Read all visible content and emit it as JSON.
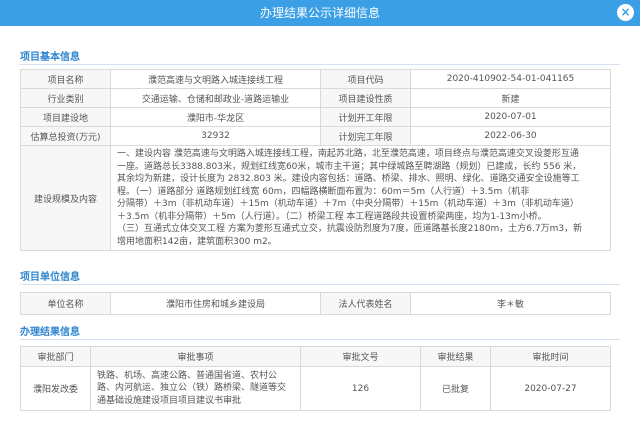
{
  "window": {
    "title": "办理结果公示详细信息",
    "close_label": "×"
  },
  "sections": {
    "basic": "项目基本信息",
    "unit": "项目单位信息",
    "result": "办理结果信息"
  },
  "basic": {
    "project_name_label": "项目名称",
    "project_name": "濮范高速与文明路入城连接线工程",
    "project_code_label": "项目代码",
    "project_code": "2020-410902-54-01-041165",
    "industry_label": "行业类别",
    "industry": "交通运输、仓储和邮政业-道路运输业",
    "nature_label": "项目建设性质",
    "nature": "新建",
    "location_label": "项目建设地",
    "location": "濮阳市-华龙区",
    "start_label": "计划开工年限",
    "start": "2020-07-01",
    "investment_label": "估算总投资(万元)",
    "investment": "32932",
    "finish_label": "计划完工年限",
    "finish": "2022-06-30",
    "scale_label": "建设规模及内容",
    "scale_lines": [
      "一、建设内容 濮范高速与文明路入城连接线工程，南起苏北路，北至濮范高速，项目终点与濮范高速交叉设菱形互通",
      "一座。道路总长3388.803米，规划红线宽60米，城市主干道；其中绿城路至聘湖路（规划）已建成，长约 556 米，",
      "其余均为新建，设计长度为 2832.803 米。建设内容包括：道路、桥梁、排水、照明、绿化、道路交通安全设施等工",
      "程。（一）道路部分 道路规划红线宽 60m，四幅路横断面布置为：60m＝5m（人行道）＋3.5m（机非",
      "分隔带）＋3m（非机动车道）＋15m（机动车道）＋7m（中央分隔带）＋15m（机动车道）＋3m（非机动车道）",
      "＋3.5m（机非分隔带）＋5m（人行道）。（二）桥梁工程 本工程道路段共设置桥梁两座，均为1-13m小桥。",
      "（三）互通式立体交叉工程 方案为菱形互通式立交，抗震设防烈度为7度，匝道路基长度2180m，土方6.7万m3，新",
      "增用地面积142亩，建筑面积300 m2。"
    ]
  },
  "unit": {
    "name_label": "单位名称",
    "name": "濮阳市住房和城乡建设局",
    "rep_label": "法人代表姓名",
    "rep": "李＊敏"
  },
  "result": {
    "headers": [
      "审批部门",
      "审批事项",
      "审批文号",
      "审批结果",
      "审批时间"
    ],
    "rows": [
      {
        "dept": "濮阳发改委",
        "item_lines": [
          "铁路、机场、高速公路、普通国省道、农村公",
          "路、内河航运、独立公（铁）路桥梁、隧道等交",
          "通基础设施建设项目项目建议书审批"
        ],
        "doc_no": "126",
        "result": "已批复",
        "date": "2020-07-27"
      }
    ]
  }
}
